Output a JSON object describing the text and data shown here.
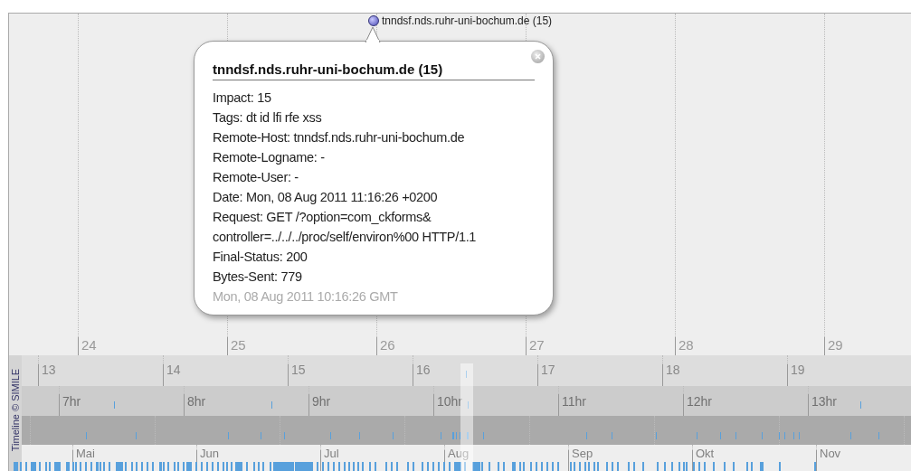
{
  "event": {
    "label": "tnndsf.nds.ruhr-uni-bochum.de (15)"
  },
  "bubble": {
    "title": "tnndsf.nds.ruhr-uni-bochum.de (15)",
    "lines": [
      "Impact: 15",
      "Tags: dt id lfi rfe xss",
      "Remote-Host: tnndsf.nds.ruhr-uni-bochum.de",
      "Remote-Logname: -",
      "Remote-User: -",
      "Date: Mon, 08 Aug 2011 11:16:26 +0200",
      "Request: GET /?option=com_ckforms&",
      "controller=../../../proc/self/environ%00 HTTP/1.1",
      "Final-Status: 200",
      "Bytes-Sent: 779"
    ],
    "footer": "Mon, 08 Aug 2011 10:16:26 GMT"
  },
  "bands": [
    {
      "kind": "day",
      "labels": [
        "24",
        "25",
        "26",
        "27",
        "28",
        "29"
      ]
    },
    {
      "kind": "day-small",
      "labels": [
        "13",
        "14",
        "15",
        "16",
        "17",
        "18",
        "19"
      ]
    },
    {
      "kind": "hour",
      "labels": [
        "7hr",
        "8hr",
        "9hr",
        "10hr",
        "11hr",
        "12hr",
        "13hr"
      ]
    },
    {
      "kind": "detail"
    },
    {
      "kind": "month",
      "labels": [
        "Mai",
        "Jun",
        "Jul",
        "Aug",
        "Sep",
        "Okt",
        "Nov"
      ]
    }
  ],
  "credit": "Timeline © SIMILE"
}
